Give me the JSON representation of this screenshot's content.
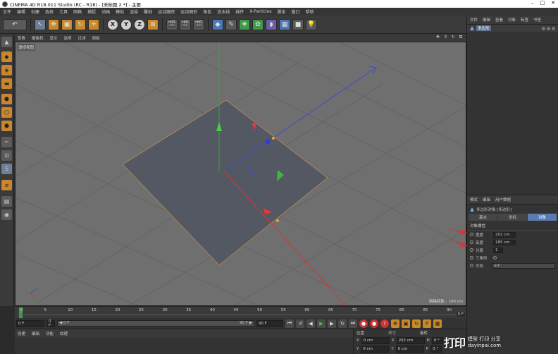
{
  "window": {
    "title": "CINEMA 4D R18.011 Studio (RC - R18) - [未标题 2 *] - 主要"
  },
  "menubar": [
    "文件",
    "编辑",
    "创建",
    "选择",
    "工具",
    "网格",
    "捕捉",
    "动画",
    "模拟",
    "渲染",
    "雕刻",
    "运动跟踪",
    "运动图形",
    "角色",
    "流水线",
    "插件",
    "X-Particles",
    "脚本",
    "窗口",
    "帮助"
  ],
  "toolbar": {
    "axis_buttons": [
      "X",
      "Y",
      "Z"
    ]
  },
  "viewport": {
    "menu": [
      "查看",
      "摄像机",
      "显示",
      "选项",
      "过滤",
      "面板"
    ],
    "camera_label": "透视视图",
    "grid_spacing": "网格间距 : 100 cm"
  },
  "timeline": {
    "ticks": [
      "0",
      "5",
      "10",
      "15",
      "20",
      "25",
      "30",
      "35",
      "40",
      "45",
      "50",
      "55",
      "60",
      "65",
      "70",
      "75",
      "80",
      "85",
      "90"
    ],
    "frame_end_label": "0 F",
    "current_frame": "0 F",
    "start_frame": "0 F",
    "slider_left": "◀ 0 F",
    "slider_right": "90 F ▶",
    "end_frame": "90 F"
  },
  "materials": {
    "menu": [
      "创建",
      "编辑",
      "功能",
      "纹理"
    ]
  },
  "coordinates": {
    "headers": [
      "位置",
      "尺寸",
      "旋转"
    ],
    "rows": [
      {
        "axis": "X",
        "pos": "0 cm",
        "size": "202 cm",
        "rot_axis": "H",
        "rot": "0 °"
      },
      {
        "axis": "Y",
        "pos": "0 cm",
        "size": "0 cm",
        "rot_axis": "P",
        "rot": "0 °"
      }
    ]
  },
  "object_manager": {
    "menu": [
      "文件",
      "编辑",
      "查看",
      "对象",
      "标签",
      "书签"
    ],
    "objects": [
      {
        "name": "多边形"
      }
    ]
  },
  "attribute_manager": {
    "menu": [
      "模式",
      "编辑",
      "用户数据"
    ],
    "title": "多边形对象 [多边形]",
    "tabs": [
      "基本",
      "坐标",
      "对象"
    ],
    "active_tab": "对象",
    "section": "对象属性",
    "fields": [
      {
        "label": "宽度",
        "value": "202 cm"
      },
      {
        "label": "高度",
        "value": "185 cm"
      },
      {
        "label": "分段",
        "value": "1"
      },
      {
        "label": "三角形",
        "value": ""
      },
      {
        "label": "方向",
        "value": "+Y"
      }
    ]
  },
  "watermark": {
    "logo": "打印",
    "line1": "模型 打印 分享",
    "line2": "dayinpai.com"
  }
}
